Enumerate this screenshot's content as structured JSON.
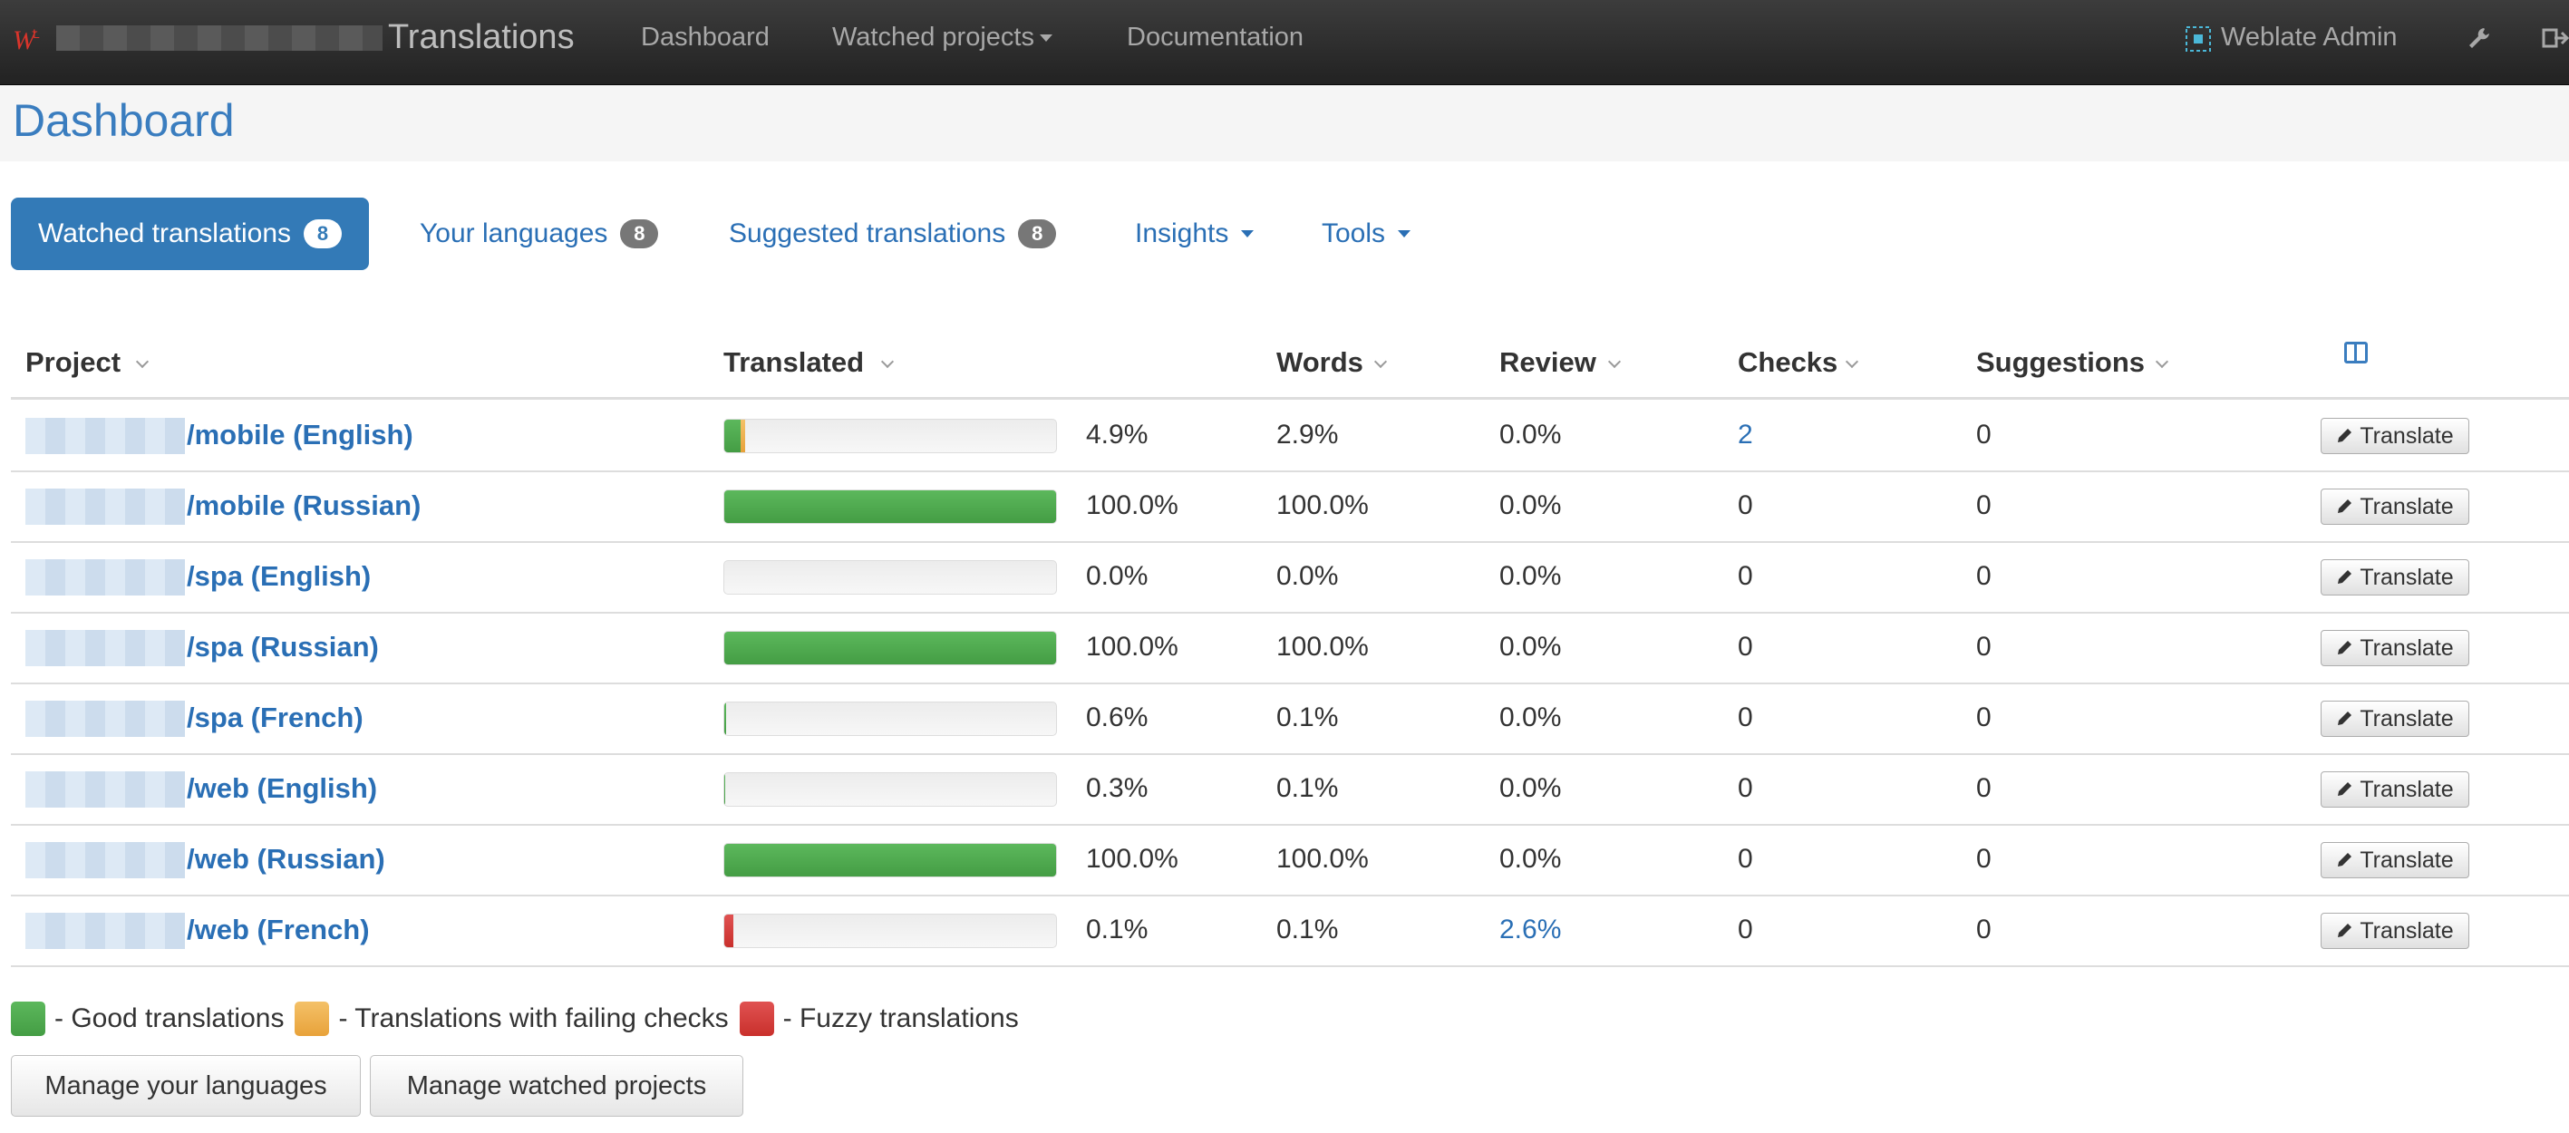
{
  "navbar": {
    "brand": "Translations",
    "items": [
      {
        "label": "Dashboard"
      },
      {
        "label": "Watched projects"
      },
      {
        "label": "Documentation"
      }
    ],
    "user": "Weblate Admin"
  },
  "page": {
    "title": "Dashboard"
  },
  "tabs": [
    {
      "label": "Watched translations",
      "badge": "8",
      "active": true
    },
    {
      "label": "Your languages",
      "badge": "8"
    },
    {
      "label": "Suggested translations",
      "badge": "8"
    },
    {
      "label": "Insights"
    },
    {
      "label": "Tools"
    }
  ],
  "table": {
    "headers": {
      "project": "Project",
      "translated": "Translated",
      "words": "Words",
      "review": "Review",
      "checks": "Checks",
      "suggestions": "Suggestions"
    },
    "action_label": "Translate",
    "rows": [
      {
        "name": "/mobile (English)",
        "good": 4.9,
        "failing": 1.5,
        "fuzzy": 0,
        "translated": "4.9%",
        "words": "2.9%",
        "review": "0.0%",
        "checks": "2",
        "suggestions": "0"
      },
      {
        "name": "/mobile (Russian)",
        "good": 100,
        "failing": 0,
        "fuzzy": 0,
        "translated": "100.0%",
        "words": "100.0%",
        "review": "0.0%",
        "checks": "0",
        "suggestions": "0"
      },
      {
        "name": "/spa (English)",
        "good": 0,
        "failing": 0,
        "fuzzy": 0,
        "translated": "0.0%",
        "words": "0.0%",
        "review": "0.0%",
        "checks": "0",
        "suggestions": "0"
      },
      {
        "name": "/spa (Russian)",
        "good": 100,
        "failing": 0,
        "fuzzy": 0,
        "translated": "100.0%",
        "words": "100.0%",
        "review": "0.0%",
        "checks": "0",
        "suggestions": "0"
      },
      {
        "name": "/spa (French)",
        "good": 0.6,
        "failing": 0,
        "fuzzy": 0,
        "translated": "0.6%",
        "words": "0.1%",
        "review": "0.0%",
        "checks": "0",
        "suggestions": "0"
      },
      {
        "name": "/web (English)",
        "good": 0.3,
        "failing": 0,
        "fuzzy": 0,
        "translated": "0.3%",
        "words": "0.1%",
        "review": "0.0%",
        "checks": "0",
        "suggestions": "0"
      },
      {
        "name": "/web (Russian)",
        "good": 100,
        "failing": 0,
        "fuzzy": 0,
        "translated": "100.0%",
        "words": "100.0%",
        "review": "0.0%",
        "checks": "0",
        "suggestions": "0"
      },
      {
        "name": "/web (French)",
        "good": 0.1,
        "failing": 0,
        "fuzzy": 2.6,
        "translated": "0.1%",
        "words": "0.1%",
        "review": "2.6%",
        "checks": "0",
        "suggestions": "0"
      }
    ]
  },
  "legend": {
    "good": "- Good translations",
    "failing": "- Translations with failing checks",
    "fuzzy": "- Fuzzy translations"
  },
  "buttons": {
    "manage_languages": "Manage your languages",
    "manage_watched": "Manage watched projects"
  },
  "colors": {
    "accent": "#337ab7",
    "good": "#5cb85c",
    "failing": "#f0ad4e",
    "fuzzy": "#d9534f"
  }
}
